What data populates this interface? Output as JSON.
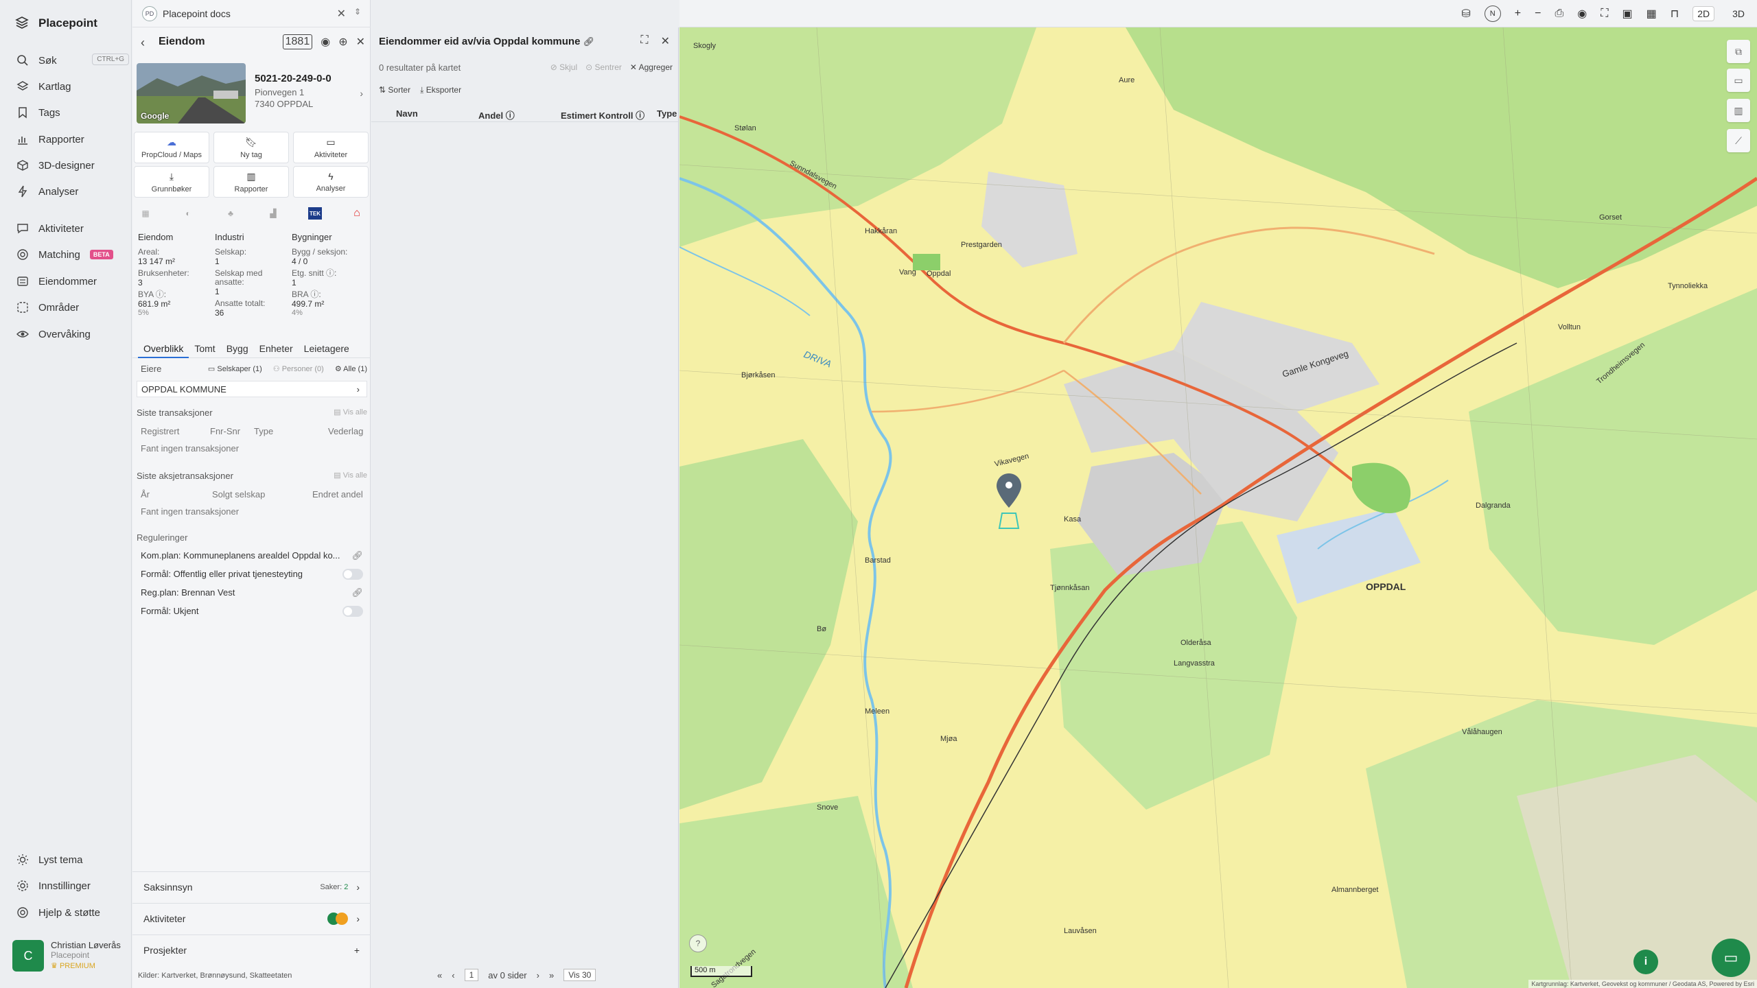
{
  "nav": {
    "brand": "Placepoint",
    "items": [
      {
        "label": "Søk",
        "icon": "search-icon",
        "shortcut": "CTRL+G"
      },
      {
        "label": "Kartlag",
        "icon": "layers-icon"
      },
      {
        "label": "Tags",
        "icon": "bookmark-icon"
      },
      {
        "label": "Rapporter",
        "icon": "chart-icon"
      },
      {
        "label": "3D-designer",
        "icon": "cube-icon"
      },
      {
        "label": "Analyser",
        "icon": "bolt-icon"
      },
      {
        "label": "Aktiviteter",
        "icon": "chat-icon"
      },
      {
        "label": "Matching",
        "icon": "target-icon",
        "badge": "BETA"
      },
      {
        "label": "Eiendommer",
        "icon": "list-icon"
      },
      {
        "label": "Områder",
        "icon": "area-icon"
      },
      {
        "label": "Overvåking",
        "icon": "eye-icon"
      }
    ],
    "bottom": [
      {
        "label": "Lyst tema",
        "icon": "sun-icon"
      },
      {
        "label": "Innstillinger",
        "icon": "gear-icon"
      },
      {
        "label": "Hjelp & støtte",
        "icon": "help-icon"
      }
    ],
    "user": {
      "initial": "C",
      "name": "Christian Løverås",
      "org": "Placepoint",
      "tier": "PREMIUM"
    }
  },
  "docs": {
    "badge": "PD",
    "title": "Placepoint docs"
  },
  "property": {
    "header": "Eiendom",
    "tag_1881": "1881",
    "photo_label": "Google",
    "id": "5021-20-249-0-0",
    "street": "Pionvegen 1",
    "city": "7340 OPPDAL",
    "actions": [
      {
        "label": "PropCloud / Maps",
        "icon": "cloud-icon"
      },
      {
        "label": "Ny tag",
        "icon": "bookmark-icon"
      },
      {
        "label": "Aktiviteter",
        "icon": "chat-icon"
      },
      {
        "label": "Grunnbøker",
        "icon": "download-icon"
      },
      {
        "label": "Rapporter",
        "icon": "chart-icon"
      },
      {
        "label": "Analyser",
        "icon": "bolt-icon"
      }
    ],
    "source_tek": "TEK",
    "stats": {
      "col1": {
        "head": "Eiendom",
        "areal_lbl": "Areal:",
        "areal_val": "13 147 m²",
        "bruk_lbl": "Bruksenheter:",
        "bruk_val": "3",
        "bya_lbl": "BYA ⓘ:",
        "bya_val": "681.9 m²",
        "bya_pct": "5%"
      },
      "col2": {
        "head": "Industri",
        "selskap_lbl": "Selskap:",
        "selskap_val": "1",
        "ansatte_lbl": "Selskap med ansatte:",
        "ansatte_val": "1",
        "ansatte_tot_lbl": "Ansatte totalt:",
        "ansatte_tot_val": "36"
      },
      "col3": {
        "head": "Bygninger",
        "bygg_lbl": "Bygg / seksjon:",
        "bygg_val": "4 / 0",
        "etg_lbl": "Etg. snitt ⓘ:",
        "etg_val": "1",
        "bra_lbl": "BRA ⓘ:",
        "bra_val": "499.7 m²",
        "bra_pct": "4%"
      }
    },
    "tabs": [
      "Overblikk",
      "Tomt",
      "Bygg",
      "Enheter",
      "Leietagere"
    ],
    "owners": {
      "label": "Eiere",
      "selskaper": "Selskaper (1)",
      "personer": "Personer (0)",
      "alle": "Alle (1)",
      "row": "OPPDAL KOMMUNE"
    },
    "transactions": {
      "title": "Siste transaksjoner",
      "vis_alle": "Vis alle",
      "cols": [
        "Registrert",
        "Fnr-Snr",
        "Type",
        "Vederlag"
      ],
      "empty": "Fant ingen transaksjoner"
    },
    "share_tx": {
      "title": "Siste aksjetransaksjoner",
      "vis_alle": "Vis alle",
      "cols": [
        "År",
        "Solgt selskap",
        "Endret andel"
      ],
      "empty": "Fant ingen transaksjoner"
    },
    "regulations": {
      "title": "Reguleringer",
      "rows": [
        {
          "text": "Kom.plan: Kommuneplanens arealdel Oppdal ko...",
          "kind": "link"
        },
        {
          "text": "Formål: Offentlig eller privat tjenesteyting",
          "kind": "toggle"
        },
        {
          "text": "Reg.plan: Brennan Vest",
          "kind": "link"
        },
        {
          "text": "Formål: Ukjent",
          "kind": "toggle"
        }
      ]
    },
    "bottom": {
      "saksinnsyn": "Saksinnsyn",
      "saker_label": "Saker:",
      "saker_count": "2",
      "aktiviteter": "Aktiviteter",
      "prosjekter": "Prosjekter"
    },
    "sources_foot": "Kilder: Kartverket, Brønnøysund, Skatteetaten"
  },
  "results": {
    "title": "Eiendommer eid av/via Oppdal kommune",
    "count": "0 resultater på kartet",
    "options": [
      "Skjul",
      "Sentrer",
      "Aggreger"
    ],
    "tools": [
      "Sorter",
      "Eksporter"
    ],
    "columns": [
      "Navn",
      "Andel ⓘ",
      "Estimert Kontroll ⓘ",
      "Type"
    ],
    "pager": {
      "page": "1",
      "of_pages": "av 0 sider",
      "per_page": "Vis 30"
    }
  },
  "map": {
    "modes": [
      "2D",
      "3D"
    ],
    "scale": "500 m",
    "attribution": "Kartgrunnlag: Kartverket, Geovekst og kommuner / Geodata AS, Powered by Esri",
    "labels": [
      "OPPDAL",
      "DRIVA",
      "Sunndalsvegen",
      "Gamle Kongeveg",
      "Vikavegen",
      "Trondheimsvegen",
      "Sagatrondvegen",
      "Stølan",
      "Vang",
      "Oppdal",
      "Prestgarden",
      "Kasa",
      "Aure",
      "Almannberget",
      "Mjøa",
      "Bø",
      "Meleen",
      "Lauvåsen",
      "Bjørkåsen",
      "Olderåsa",
      "Langvasstra",
      "Vålåhaugen",
      "Dalgranda",
      "Barstad",
      "Tjønnkåsan",
      "Snove",
      "Hakkåran",
      "Skogly",
      "Gorset",
      "Volltun",
      "Tynnoliekka"
    ],
    "colors": {
      "base": "#f5f0a6",
      "forest": "#b8e08e",
      "road": "#e8663a",
      "river": "#7cc4e8",
      "built": "#c9c9c9"
    }
  }
}
